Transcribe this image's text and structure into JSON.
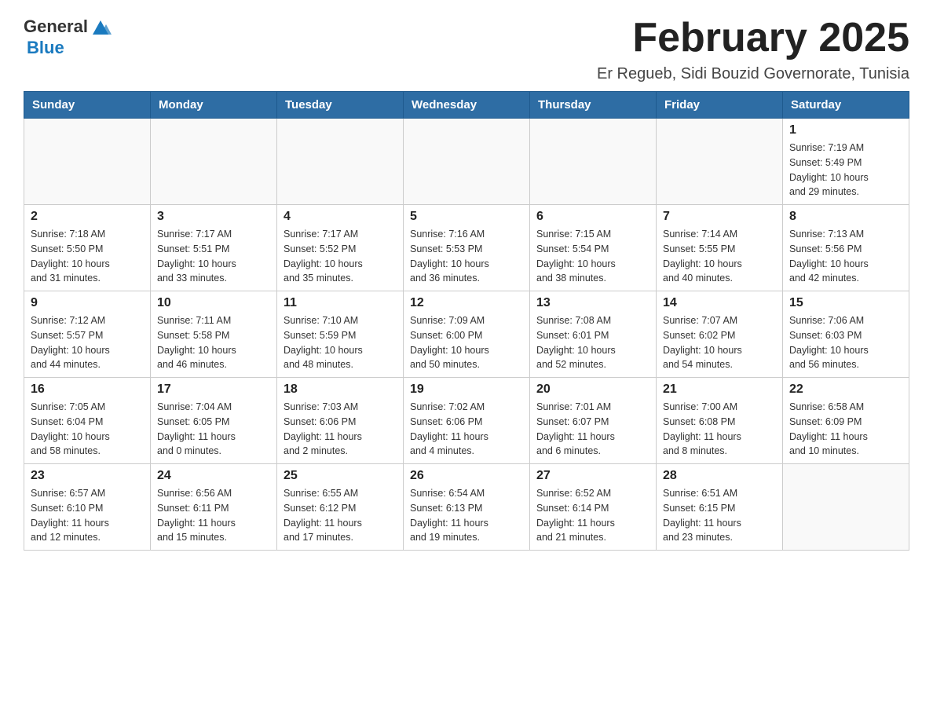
{
  "header": {
    "logo_general": "General",
    "logo_blue": "Blue",
    "title": "February 2025",
    "subtitle": "Er Regueb, Sidi Bouzid Governorate, Tunisia"
  },
  "calendar": {
    "headers": [
      "Sunday",
      "Monday",
      "Tuesday",
      "Wednesday",
      "Thursday",
      "Friday",
      "Saturday"
    ],
    "weeks": [
      [
        {
          "day": "",
          "info": ""
        },
        {
          "day": "",
          "info": ""
        },
        {
          "day": "",
          "info": ""
        },
        {
          "day": "",
          "info": ""
        },
        {
          "day": "",
          "info": ""
        },
        {
          "day": "",
          "info": ""
        },
        {
          "day": "1",
          "info": "Sunrise: 7:19 AM\nSunset: 5:49 PM\nDaylight: 10 hours\nand 29 minutes."
        }
      ],
      [
        {
          "day": "2",
          "info": "Sunrise: 7:18 AM\nSunset: 5:50 PM\nDaylight: 10 hours\nand 31 minutes."
        },
        {
          "day": "3",
          "info": "Sunrise: 7:17 AM\nSunset: 5:51 PM\nDaylight: 10 hours\nand 33 minutes."
        },
        {
          "day": "4",
          "info": "Sunrise: 7:17 AM\nSunset: 5:52 PM\nDaylight: 10 hours\nand 35 minutes."
        },
        {
          "day": "5",
          "info": "Sunrise: 7:16 AM\nSunset: 5:53 PM\nDaylight: 10 hours\nand 36 minutes."
        },
        {
          "day": "6",
          "info": "Sunrise: 7:15 AM\nSunset: 5:54 PM\nDaylight: 10 hours\nand 38 minutes."
        },
        {
          "day": "7",
          "info": "Sunrise: 7:14 AM\nSunset: 5:55 PM\nDaylight: 10 hours\nand 40 minutes."
        },
        {
          "day": "8",
          "info": "Sunrise: 7:13 AM\nSunset: 5:56 PM\nDaylight: 10 hours\nand 42 minutes."
        }
      ],
      [
        {
          "day": "9",
          "info": "Sunrise: 7:12 AM\nSunset: 5:57 PM\nDaylight: 10 hours\nand 44 minutes."
        },
        {
          "day": "10",
          "info": "Sunrise: 7:11 AM\nSunset: 5:58 PM\nDaylight: 10 hours\nand 46 minutes."
        },
        {
          "day": "11",
          "info": "Sunrise: 7:10 AM\nSunset: 5:59 PM\nDaylight: 10 hours\nand 48 minutes."
        },
        {
          "day": "12",
          "info": "Sunrise: 7:09 AM\nSunset: 6:00 PM\nDaylight: 10 hours\nand 50 minutes."
        },
        {
          "day": "13",
          "info": "Sunrise: 7:08 AM\nSunset: 6:01 PM\nDaylight: 10 hours\nand 52 minutes."
        },
        {
          "day": "14",
          "info": "Sunrise: 7:07 AM\nSunset: 6:02 PM\nDaylight: 10 hours\nand 54 minutes."
        },
        {
          "day": "15",
          "info": "Sunrise: 7:06 AM\nSunset: 6:03 PM\nDaylight: 10 hours\nand 56 minutes."
        }
      ],
      [
        {
          "day": "16",
          "info": "Sunrise: 7:05 AM\nSunset: 6:04 PM\nDaylight: 10 hours\nand 58 minutes."
        },
        {
          "day": "17",
          "info": "Sunrise: 7:04 AM\nSunset: 6:05 PM\nDaylight: 11 hours\nand 0 minutes."
        },
        {
          "day": "18",
          "info": "Sunrise: 7:03 AM\nSunset: 6:06 PM\nDaylight: 11 hours\nand 2 minutes."
        },
        {
          "day": "19",
          "info": "Sunrise: 7:02 AM\nSunset: 6:06 PM\nDaylight: 11 hours\nand 4 minutes."
        },
        {
          "day": "20",
          "info": "Sunrise: 7:01 AM\nSunset: 6:07 PM\nDaylight: 11 hours\nand 6 minutes."
        },
        {
          "day": "21",
          "info": "Sunrise: 7:00 AM\nSunset: 6:08 PM\nDaylight: 11 hours\nand 8 minutes."
        },
        {
          "day": "22",
          "info": "Sunrise: 6:58 AM\nSunset: 6:09 PM\nDaylight: 11 hours\nand 10 minutes."
        }
      ],
      [
        {
          "day": "23",
          "info": "Sunrise: 6:57 AM\nSunset: 6:10 PM\nDaylight: 11 hours\nand 12 minutes."
        },
        {
          "day": "24",
          "info": "Sunrise: 6:56 AM\nSunset: 6:11 PM\nDaylight: 11 hours\nand 15 minutes."
        },
        {
          "day": "25",
          "info": "Sunrise: 6:55 AM\nSunset: 6:12 PM\nDaylight: 11 hours\nand 17 minutes."
        },
        {
          "day": "26",
          "info": "Sunrise: 6:54 AM\nSunset: 6:13 PM\nDaylight: 11 hours\nand 19 minutes."
        },
        {
          "day": "27",
          "info": "Sunrise: 6:52 AM\nSunset: 6:14 PM\nDaylight: 11 hours\nand 21 minutes."
        },
        {
          "day": "28",
          "info": "Sunrise: 6:51 AM\nSunset: 6:15 PM\nDaylight: 11 hours\nand 23 minutes."
        },
        {
          "day": "",
          "info": ""
        }
      ]
    ]
  }
}
